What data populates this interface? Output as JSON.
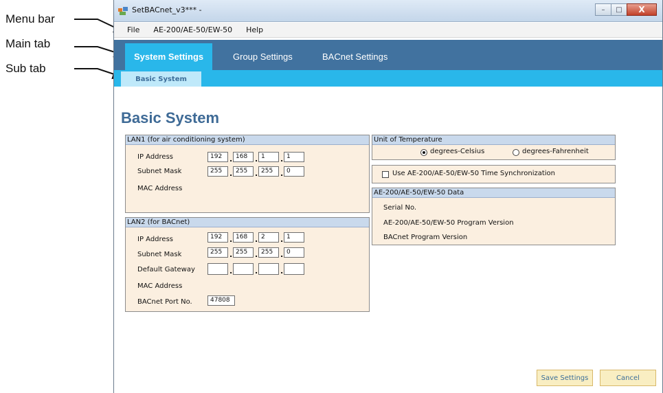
{
  "callouts": {
    "menu_bar": "Menu bar",
    "main_tab": "Main tab",
    "sub_tab": "Sub tab"
  },
  "window": {
    "title": "SetBACnet_v3*** -",
    "controls": {
      "minimize": "–",
      "maximize": "□",
      "close": "X"
    }
  },
  "menubar": {
    "file": "File",
    "device": "AE-200/AE-50/EW-50",
    "help": "Help"
  },
  "main_tabs": [
    "System Settings",
    "Group Settings",
    "BACnet Settings"
  ],
  "sub_tabs": [
    "Basic System"
  ],
  "page_title": "Basic System",
  "lan1": {
    "title": "LAN1 (for air conditioning system)",
    "ip_label": "IP Address",
    "ip": [
      "192",
      "168",
      "1",
      "1"
    ],
    "subnet_label": "Subnet Mask",
    "subnet": [
      "255",
      "255",
      "255",
      "0"
    ],
    "mac_label": "MAC Address"
  },
  "lan2": {
    "title": "LAN2 (for BACnet)",
    "ip_label": "IP Address",
    "ip": [
      "192",
      "168",
      "2",
      "1"
    ],
    "subnet_label": "Subnet Mask",
    "subnet": [
      "255",
      "255",
      "255",
      "0"
    ],
    "gateway_label": "Default Gateway",
    "gateway": [
      "",
      "",
      "",
      ""
    ],
    "mac_label": "MAC Address",
    "port_label": "BACnet Port No.",
    "port": "47808"
  },
  "temperature": {
    "title": "Unit of Temperature",
    "celsius": "degrees-Celsius",
    "fahrenheit": "degrees-Fahrenheit",
    "selected": "degrees-Celsius"
  },
  "time_sync": {
    "label": "Use AE-200/AE-50/EW-50 Time Synchronization",
    "checked": false
  },
  "device_data": {
    "title": "AE-200/AE-50/EW-50 Data",
    "serial_label": "Serial No.",
    "program_version_label": "AE-200/AE-50/EW-50 Program Version",
    "bacnet_version_label": "BACnet Program Version"
  },
  "buttons": {
    "save": "Save Settings",
    "cancel": "Cancel"
  },
  "colors": {
    "main_tab_bar": "#41729f",
    "active_tab": "#29b7ea",
    "group_bg": "#fbefe0",
    "group_header": "#c9d9ec",
    "title_blue": "#3e6a96",
    "button_bg": "#f9eec2"
  }
}
